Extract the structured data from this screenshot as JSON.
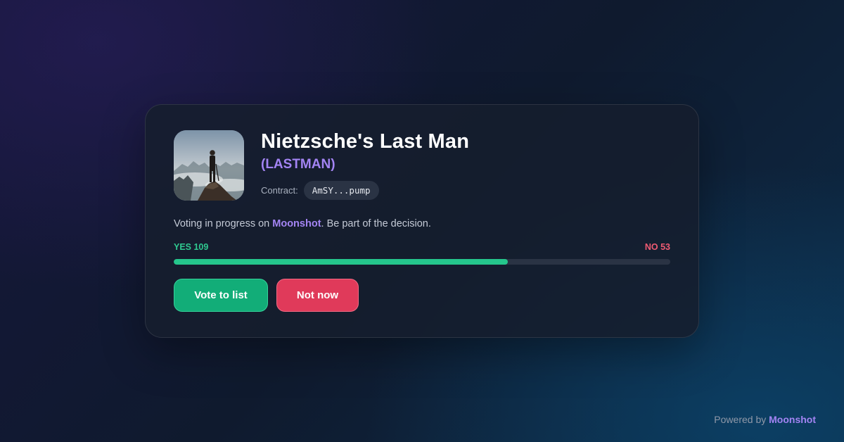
{
  "token": {
    "name": "Nietzsche's Last Man",
    "ticker": "(LASTMAN)",
    "contract_label": "Contract:",
    "contract_address": "AmSY...pump"
  },
  "description": {
    "prefix": "Voting in progress on ",
    "platform": "Moonshot",
    "suffix": ". Be part of the decision."
  },
  "votes": {
    "yes_label": "YES 109",
    "no_label": "NO 53",
    "yes": 109,
    "no": 53
  },
  "actions": {
    "vote_label": "Vote to list",
    "decline_label": "Not now"
  },
  "footer": {
    "prefix": "Powered by ",
    "brand": "Moonshot"
  },
  "colors": {
    "accent": "#a384f3",
    "yes": "#2fc990",
    "no": "#ef5b73"
  }
}
